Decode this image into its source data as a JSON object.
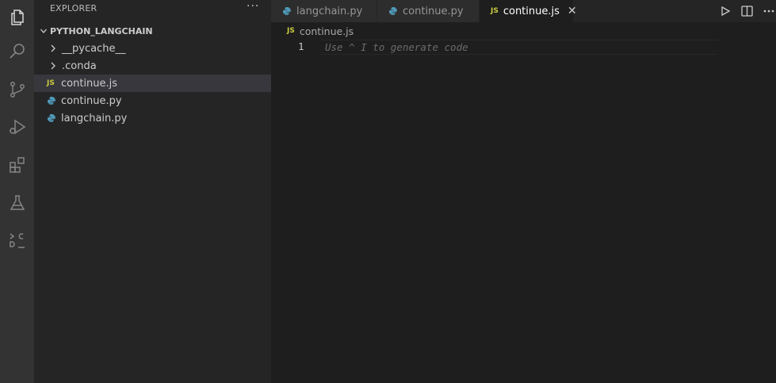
{
  "sidebar": {
    "title": "EXPLORER",
    "more": "···",
    "section": "PYTHON_LANGCHAIN",
    "items": [
      {
        "label": "__pycache__",
        "type": "folder"
      },
      {
        "label": ".conda",
        "type": "folder"
      },
      {
        "label": "continue.js",
        "type": "js",
        "selected": true
      },
      {
        "label": "continue.py",
        "type": "python"
      },
      {
        "label": "langchain.py",
        "type": "python"
      }
    ]
  },
  "tabs": [
    {
      "label": "langchain.py",
      "icon": "python-icon"
    },
    {
      "label": "continue.py",
      "icon": "python-icon"
    },
    {
      "label": "continue.js",
      "icon": "js-icon",
      "active": true,
      "close": "✕"
    }
  ],
  "badges": {
    "js": "JS"
  },
  "breadcrumb": {
    "file": "continue.js"
  },
  "editor": {
    "line_number": "1",
    "placeholder": "Use ^ I to generate code"
  },
  "activity_bar": [
    "explorer-icon",
    "search-icon",
    "source-control-icon",
    "run-debug-icon",
    "extensions-icon",
    "testing-icon",
    "continue-icon"
  ],
  "colors": {
    "accent_js": "#cbcb41",
    "accent_python": "#519aba",
    "activity_bar": "#333333",
    "sidebar": "#252526",
    "editor": "#1e1e1e"
  }
}
